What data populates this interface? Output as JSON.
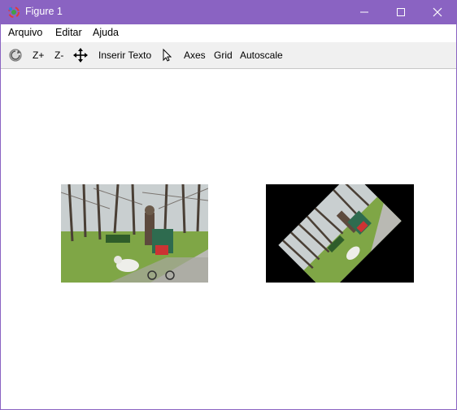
{
  "window": {
    "title": "Figure 1",
    "accent_color": "#8a63c2",
    "icons": [
      "app-icon",
      "minimize-icon",
      "maximize-icon",
      "close-icon"
    ]
  },
  "menu": {
    "items": [
      "Arquivo",
      "Editar",
      "Ajuda"
    ]
  },
  "toolbar": {
    "reset_icon": "reset-view-icon",
    "zoom_in": "Z+",
    "zoom_out": "Z-",
    "pan_icon": "pan-icon",
    "insert_text": "Inserir Texto",
    "pointer_icon": "pointer-icon",
    "axes": "Axes",
    "grid": "Grid",
    "autoscale": "Autoscale"
  },
  "figure": {
    "panels": [
      {
        "content": "park photo: person with stroller and dog",
        "rotation_deg": 0
      },
      {
        "content": "same park photo rotated",
        "rotation_deg": -45
      }
    ]
  }
}
